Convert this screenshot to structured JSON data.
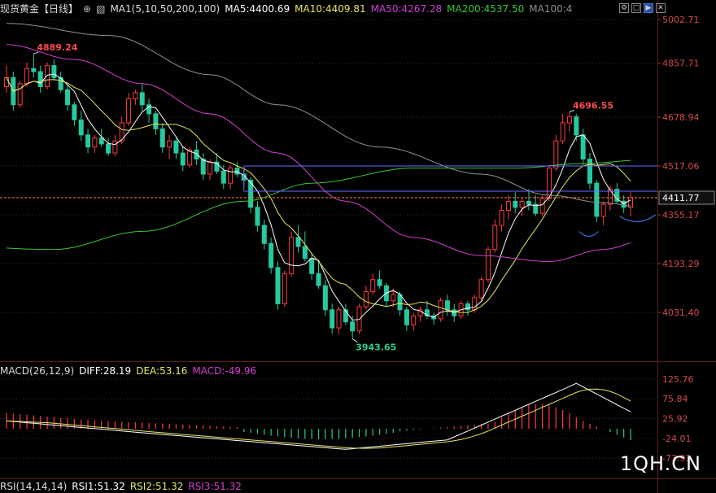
{
  "header": {
    "symbol": "现货黄金",
    "period": "【日线】",
    "ma_label": "MA1(5,10,50,200,100)",
    "ma5": "MA5:4400.69",
    "ma10": "MA10:4409.81",
    "ma50": "MA50:4267.28",
    "ma200": "MA200:4537.50",
    "ma100": "MA100:4"
  },
  "macd_header": {
    "label": "MACD(26,12,9)",
    "diff": "DIFF:28.19",
    "dea": "DEA:53.16",
    "macd": "MACD:-49.96"
  },
  "rsi_header": {
    "label": "RSI(14,14,14)",
    "rsi1": "RSI1:51.32",
    "rsi2": "RSI2:51.32",
    "rsi3": "RSI3:51.32"
  },
  "watermark": "1QH.CN",
  "colors": {
    "up": "#ff3b3b",
    "down": "#26c9a0",
    "ma5": "#ffffff",
    "ma10": "#e8e85a",
    "ma50": "#d23fd2",
    "ma200": "#38c838",
    "ma100": "#909090",
    "price_line": "#ff8c1a",
    "box": "#6a6aff",
    "grid": "#5a1e1e"
  },
  "chart_data": [
    {
      "type": "candlestick",
      "title": "现货黄金【日线】",
      "y_ticks": [
        "5002.71",
        "4857.71",
        "4678.94",
        "4517.06",
        "4355.17",
        "4193.29",
        "4031.40"
      ],
      "y_tick_values": [
        5002.71,
        4857.71,
        4678.94,
        4517.06,
        4355.17,
        4193.29,
        4031.4
      ],
      "current_price_label": "4411.77",
      "current_price": 4411.77,
      "ylim": [
        3900,
        5002.71
      ],
      "annotations": [
        {
          "text": "4889.24",
          "price": 4889.24,
          "kind": "high"
        },
        {
          "text": "4696.55",
          "price": 4696.55,
          "kind": "high"
        },
        {
          "text": "3943.65",
          "price": 3943.65,
          "kind": "low"
        }
      ],
      "moving_averages": [
        "MA5",
        "MA10",
        "MA50",
        "MA200",
        "MA100"
      ],
      "box_levels": [
        4517.06,
        4411.77
      ],
      "ohlc": [
        [
          4780,
          4850,
          4760,
          4810
        ],
        [
          4810,
          4830,
          4700,
          4720
        ],
        [
          4720,
          4800,
          4710,
          4790
        ],
        [
          4790,
          4860,
          4780,
          4840
        ],
        [
          4840,
          4889,
          4810,
          4830
        ],
        [
          4830,
          4850,
          4760,
          4780
        ],
        [
          4780,
          4860,
          4770,
          4850
        ],
        [
          4850,
          4870,
          4800,
          4810
        ],
        [
          4810,
          4830,
          4760,
          4770
        ],
        [
          4770,
          4790,
          4700,
          4720
        ],
        [
          4720,
          4730,
          4650,
          4670
        ],
        [
          4670,
          4700,
          4600,
          4620
        ],
        [
          4620,
          4640,
          4560,
          4580
        ],
        [
          4580,
          4620,
          4560,
          4610
        ],
        [
          4610,
          4640,
          4580,
          4590
        ],
        [
          4590,
          4610,
          4550,
          4560
        ],
        [
          4560,
          4620,
          4550,
          4600
        ],
        [
          4600,
          4680,
          4590,
          4660
        ],
        [
          4660,
          4760,
          4650,
          4740
        ],
        [
          4740,
          4770,
          4720,
          4760
        ],
        [
          4760,
          4790,
          4700,
          4720
        ],
        [
          4720,
          4740,
          4660,
          4690
        ],
        [
          4690,
          4700,
          4620,
          4640
        ],
        [
          4640,
          4660,
          4560,
          4580
        ],
        [
          4580,
          4620,
          4540,
          4600
        ],
        [
          4600,
          4610,
          4540,
          4560
        ],
        [
          4560,
          4580,
          4500,
          4520
        ],
        [
          4520,
          4580,
          4510,
          4570
        ],
        [
          4570,
          4600,
          4520,
          4540
        ],
        [
          4540,
          4560,
          4470,
          4490
        ],
        [
          4490,
          4540,
          4470,
          4530
        ],
        [
          4530,
          4560,
          4490,
          4500
        ],
        [
          4500,
          4520,
          4440,
          4460
        ],
        [
          4460,
          4520,
          4440,
          4510
        ],
        [
          4510,
          4530,
          4480,
          4490
        ],
        [
          4490,
          4510,
          4450,
          4470
        ],
        [
          4470,
          4480,
          4360,
          4380
        ],
        [
          4380,
          4400,
          4300,
          4320
        ],
        [
          4320,
          4340,
          4240,
          4260
        ],
        [
          4260,
          4280,
          4160,
          4180
        ],
        [
          4180,
          4200,
          4040,
          4060
        ],
        [
          4060,
          4170,
          4050,
          4160
        ],
        [
          4160,
          4300,
          4150,
          4280
        ],
        [
          4280,
          4320,
          4230,
          4250
        ],
        [
          4250,
          4300,
          4200,
          4210
        ],
        [
          4210,
          4230,
          4140,
          4160
        ],
        [
          4160,
          4200,
          4110,
          4120
        ],
        [
          4120,
          4140,
          4020,
          4040
        ],
        [
          4040,
          4060,
          3960,
          3980
        ],
        [
          3980,
          4050,
          3960,
          4040
        ],
        [
          4040,
          4060,
          3990,
          4000
        ],
        [
          4000,
          4020,
          3944,
          3970
        ],
        [
          3970,
          4060,
          3960,
          4050
        ],
        [
          4050,
          4120,
          4040,
          4100
        ],
        [
          4100,
          4160,
          4090,
          4140
        ],
        [
          4140,
          4170,
          4110,
          4120
        ],
        [
          4120,
          4130,
          4050,
          4070
        ],
        [
          4070,
          4110,
          4050,
          4090
        ],
        [
          4090,
          4100,
          4020,
          4040
        ],
        [
          4040,
          4050,
          3970,
          3990
        ],
        [
          3990,
          4030,
          3970,
          4020
        ],
        [
          4020,
          4050,
          4000,
          4040
        ],
        [
          4040,
          4070,
          4010,
          4020
        ],
        [
          4020,
          4030,
          3990,
          4010
        ],
        [
          4010,
          4080,
          4000,
          4070
        ],
        [
          4070,
          4090,
          4020,
          4040
        ],
        [
          4040,
          4060,
          4000,
          4020
        ],
        [
          4020,
          4070,
          4010,
          4060
        ],
        [
          4060,
          4070,
          4020,
          4040
        ],
        [
          4040,
          4090,
          4030,
          4080
        ],
        [
          4080,
          4150,
          4070,
          4140
        ],
        [
          4140,
          4250,
          4130,
          4240
        ],
        [
          4240,
          4340,
          4230,
          4320
        ],
        [
          4320,
          4390,
          4300,
          4370
        ],
        [
          4370,
          4420,
          4340,
          4400
        ],
        [
          4400,
          4430,
          4360,
          4380
        ],
        [
          4380,
          4410,
          4350,
          4400
        ],
        [
          4400,
          4440,
          4370,
          4390
        ],
        [
          4390,
          4420,
          4350,
          4360
        ],
        [
          4360,
          4420,
          4350,
          4410
        ],
        [
          4410,
          4520,
          4400,
          4510
        ],
        [
          4510,
          4620,
          4500,
          4600
        ],
        [
          4600,
          4690,
          4590,
          4660
        ],
        [
          4660,
          4697,
          4630,
          4680
        ],
        [
          4680,
          4690,
          4600,
          4620
        ],
        [
          4620,
          4640,
          4520,
          4540
        ],
        [
          4540,
          4560,
          4440,
          4460
        ],
        [
          4460,
          4470,
          4330,
          4350
        ],
        [
          4350,
          4400,
          4320,
          4390
        ],
        [
          4390,
          4450,
          4370,
          4440
        ],
        [
          4440,
          4460,
          4390,
          4400
        ],
        [
          4400,
          4420,
          4360,
          4380
        ],
        [
          4380,
          4430,
          4350,
          4412
        ]
      ]
    },
    {
      "type": "macd",
      "title": "MACD(26,12,9)",
      "y_ticks": [
        "125.76",
        "75.84",
        "25.92",
        "-24.01",
        "-73.93"
      ],
      "y_tick_values": [
        125.76,
        75.84,
        25.92,
        -24.01,
        -73.93
      ],
      "series": [
        {
          "name": "DIFF",
          "value": 28.19
        },
        {
          "name": "DEA",
          "value": 53.16
        },
        {
          "name": "MACD",
          "value": -49.96
        }
      ]
    },
    {
      "type": "line",
      "title": "RSI(14,14,14)",
      "series": [
        {
          "name": "RSI1",
          "value": 51.32
        },
        {
          "name": "RSI2",
          "value": 51.32
        },
        {
          "name": "RSI3",
          "value": 51.32
        }
      ]
    }
  ]
}
